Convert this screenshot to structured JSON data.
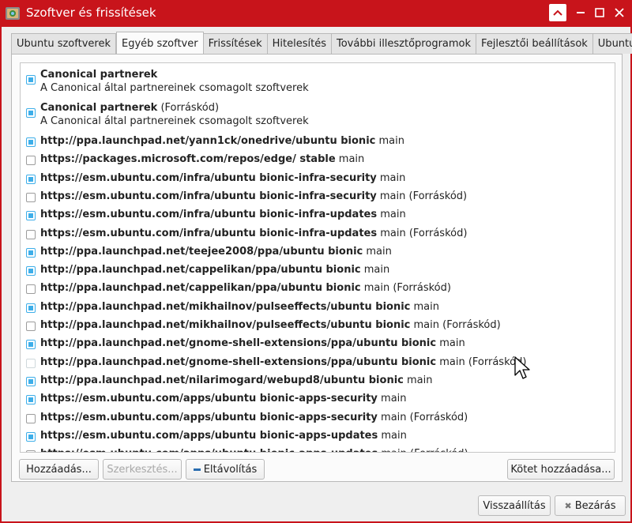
{
  "window": {
    "title": "Szoftver és frissítések"
  },
  "tabs": [
    {
      "label": "Ubuntu szoftverek",
      "active": false
    },
    {
      "label": "Egyéb szoftver",
      "active": true
    },
    {
      "label": "Frissítések",
      "active": false
    },
    {
      "label": "Hitelesítés",
      "active": false
    },
    {
      "label": "További illesztőprogramok",
      "active": false
    },
    {
      "label": "Fejlesztői beállítások",
      "active": false
    },
    {
      "label": "Ubuntu Pro",
      "active": false
    }
  ],
  "sources": [
    {
      "bold": "Canonical partnerek",
      "rest": "",
      "sub": "A Canonical által partnereinek csomagolt szoftverek",
      "checked": true
    },
    {
      "bold": "Canonical partnerek",
      "rest": " (Forráskód)",
      "sub": "A Canonical által partnereinek csomagolt szoftverek",
      "checked": true
    },
    {
      "bold": "http://ppa.launchpad.net/yann1ck/onedrive/ubuntu bionic",
      "rest": " main",
      "checked": true
    },
    {
      "bold": "https://packages.microsoft.com/repos/edge/ stable",
      "rest": " main",
      "checked": false
    },
    {
      "bold": "https://esm.ubuntu.com/infra/ubuntu bionic-infra-security",
      "rest": " main",
      "checked": true
    },
    {
      "bold": "https://esm.ubuntu.com/infra/ubuntu bionic-infra-security",
      "rest": " main (Forráskód)",
      "checked": false
    },
    {
      "bold": "https://esm.ubuntu.com/infra/ubuntu bionic-infra-updates",
      "rest": " main",
      "checked": true
    },
    {
      "bold": "https://esm.ubuntu.com/infra/ubuntu bionic-infra-updates",
      "rest": " main (Forráskód)",
      "checked": false
    },
    {
      "bold": "http://ppa.launchpad.net/teejee2008/ppa/ubuntu bionic",
      "rest": " main",
      "checked": true
    },
    {
      "bold": "http://ppa.launchpad.net/cappelikan/ppa/ubuntu bionic",
      "rest": " main",
      "checked": true
    },
    {
      "bold": "http://ppa.launchpad.net/cappelikan/ppa/ubuntu bionic",
      "rest": " main (Forráskód)",
      "checked": false
    },
    {
      "bold": "http://ppa.launchpad.net/mikhailnov/pulseeffects/ubuntu bionic",
      "rest": " main",
      "checked": true
    },
    {
      "bold": "http://ppa.launchpad.net/mikhailnov/pulseeffects/ubuntu bionic",
      "rest": " main (Forráskód)",
      "checked": false
    },
    {
      "bold": "http://ppa.launchpad.net/gnome-shell-extensions/ppa/ubuntu bionic",
      "rest": " main",
      "checked": true
    },
    {
      "bold": "http://ppa.launchpad.net/gnome-shell-extensions/ppa/ubuntu bionic",
      "rest": " main (Forráskód)",
      "checked": false
    },
    {
      "bold": "http://ppa.launchpad.net/nilarimogard/webupd8/ubuntu bionic",
      "rest": " main",
      "checked": true
    },
    {
      "bold": "https://esm.ubuntu.com/apps/ubuntu bionic-apps-security",
      "rest": " main",
      "checked": true
    },
    {
      "bold": "https://esm.ubuntu.com/apps/ubuntu bionic-apps-security",
      "rest": " main (Forráskód)",
      "checked": false
    },
    {
      "bold": "https://esm.ubuntu.com/apps/ubuntu bionic-apps-updates",
      "rest": " main",
      "checked": true
    },
    {
      "bold": "https://esm.ubuntu.com/apps/ubuntu bionic-apps-updates",
      "rest": " main (Forráskód)",
      "checked": false
    }
  ],
  "buttons": {
    "add": "Hozzáadás...",
    "edit": "Szerkesztés...",
    "remove": "Eltávolítás",
    "add_volume": "Kötet hozzáadása...",
    "revert": "Visszaállítás",
    "close": "Bezárás"
  },
  "colors": {
    "titlebar": "#c8141b",
    "accent": "#3daee9"
  }
}
